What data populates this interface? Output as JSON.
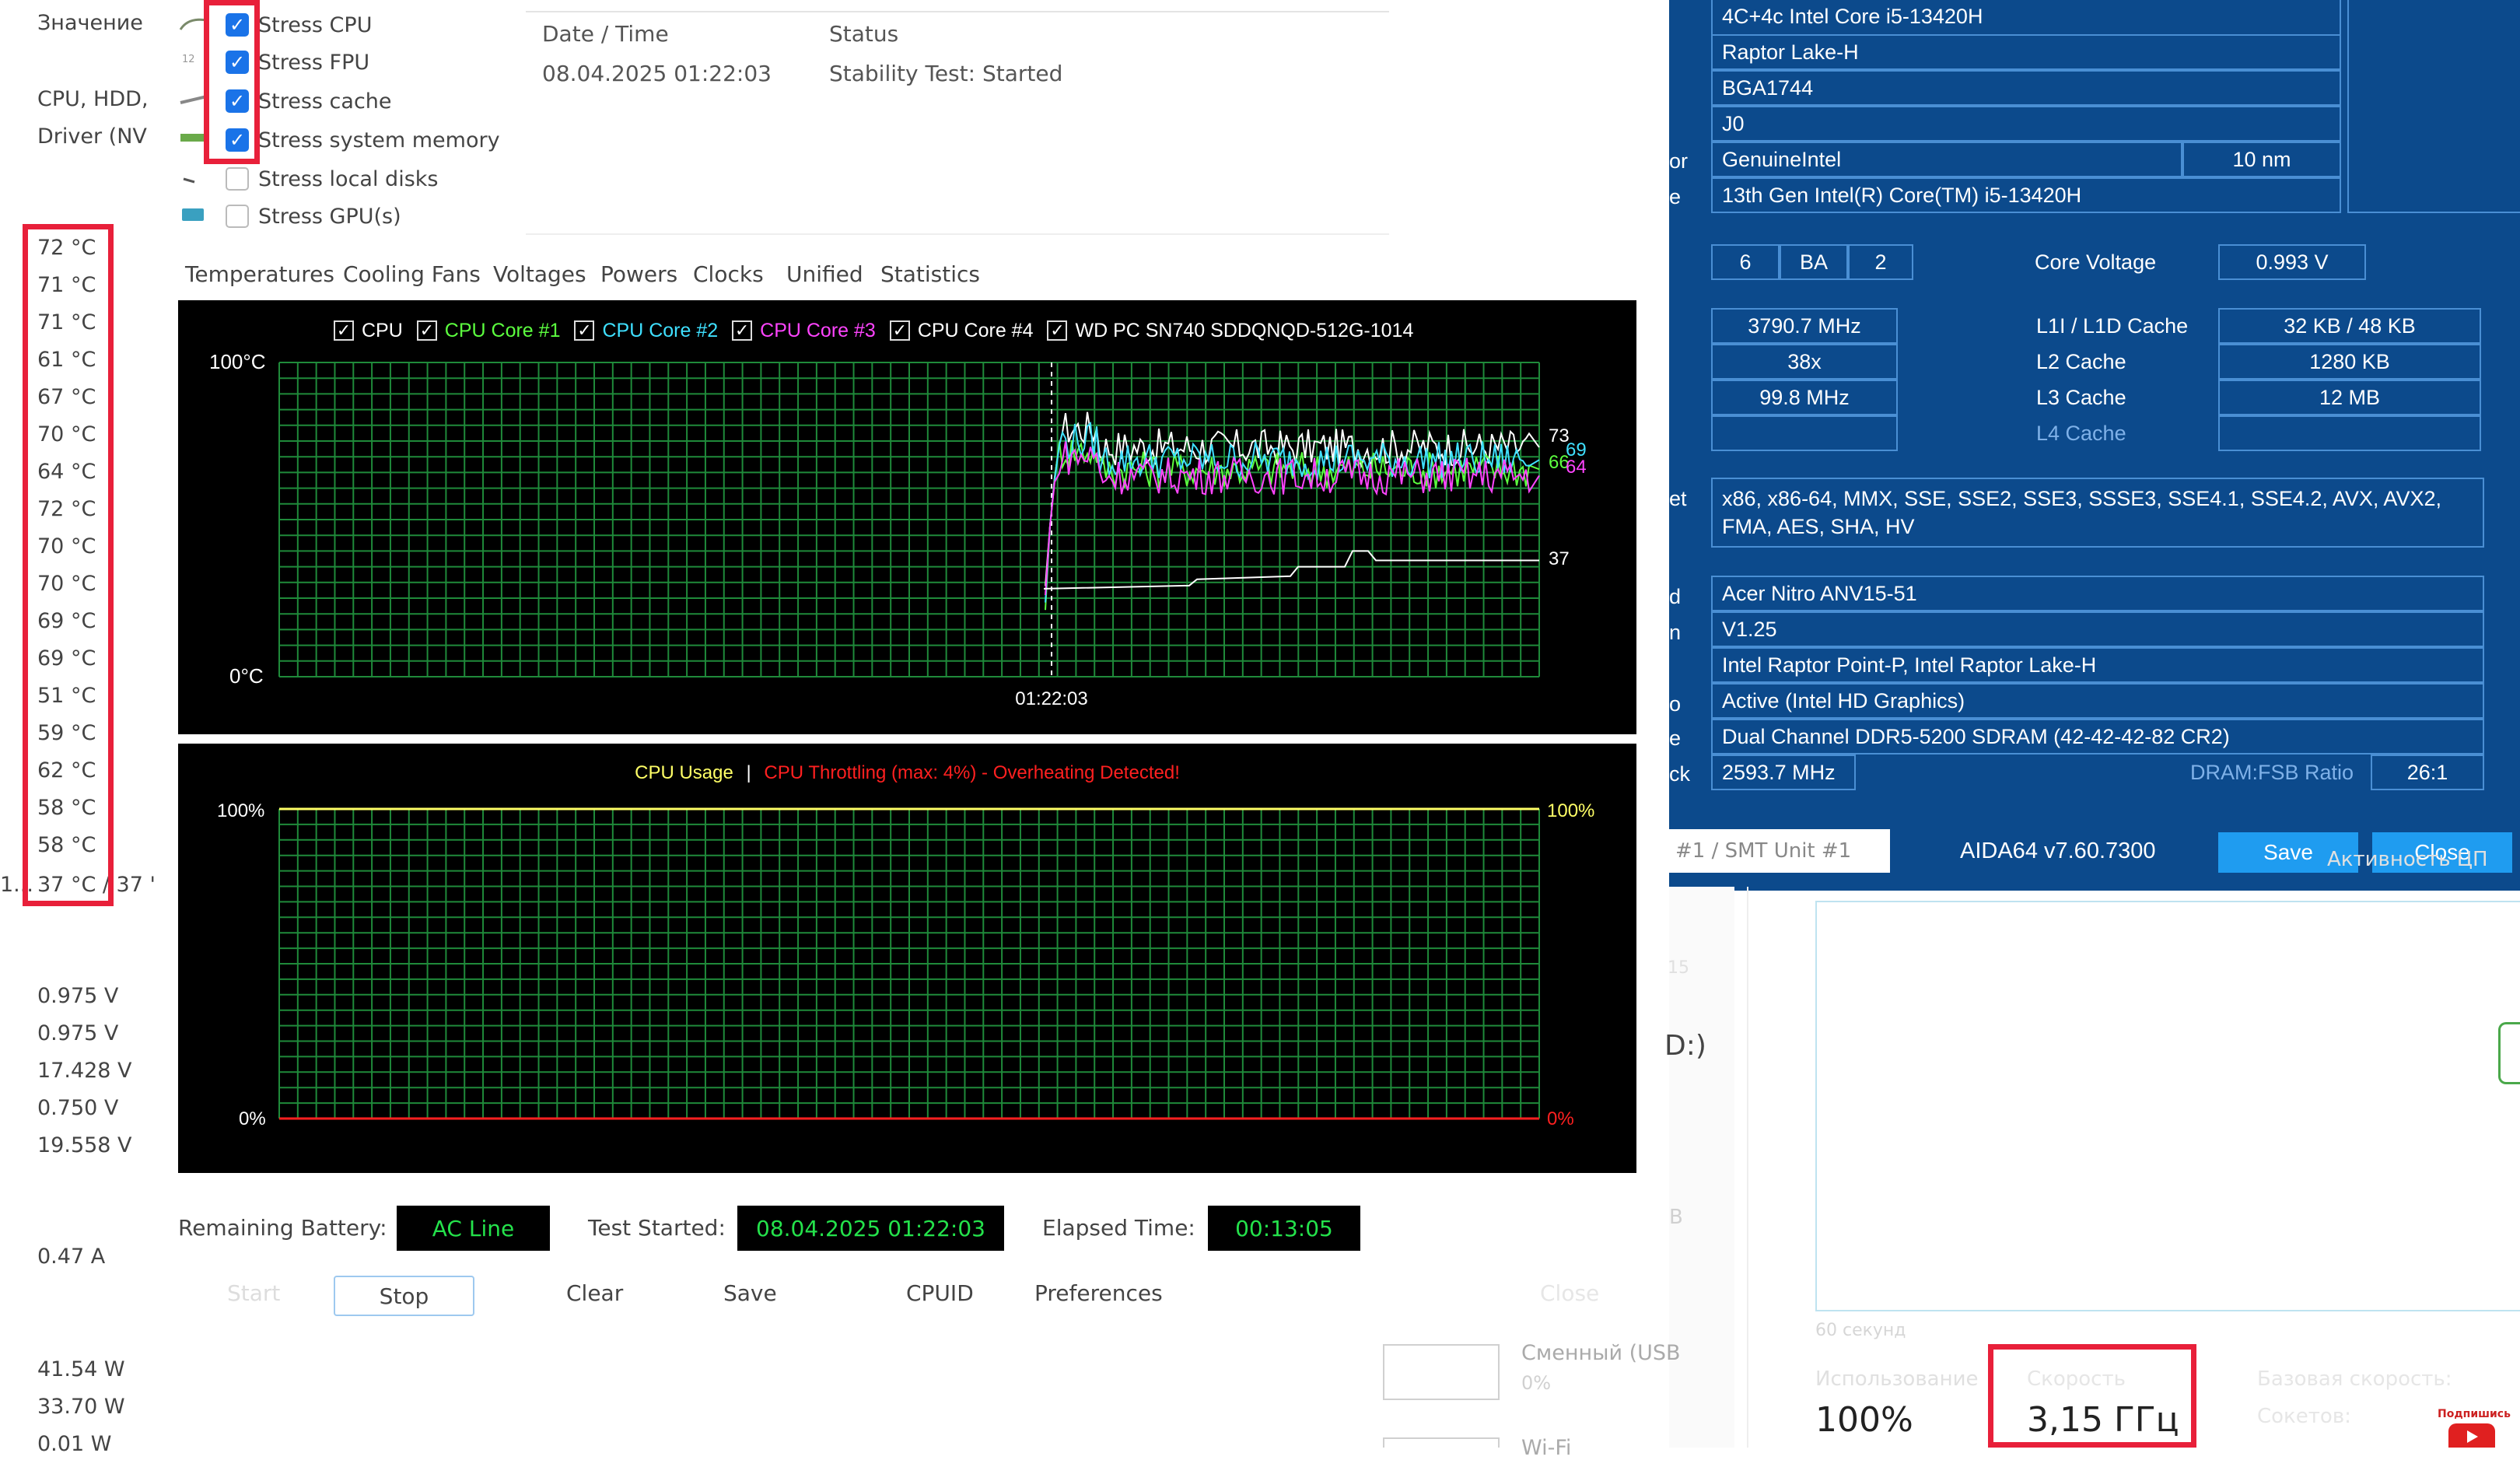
{
  "left_column": {
    "header": "Значение",
    "device_lines": [
      "CPU, HDD,",
      "Driver (NV"
    ],
    "temperatures": [
      "72 °C",
      "71 °C",
      "71 °C",
      "61 °C",
      "67 °C",
      "70 °C",
      "64 °C",
      "72 °C",
      "70 °C",
      "70 °C",
      "69 °C",
      "69 °C",
      "51 °C",
      "59 °C",
      "62 °C",
      "58 °C",
      "58 °C"
    ],
    "last_temp_prefix": "1...",
    "last_temp": "37 °C / 37 '",
    "voltages": [
      "0.975 V",
      "0.975 V",
      "17.428 V",
      "0.750 V",
      "19.558 V"
    ],
    "current": "0.47 A",
    "powers": [
      "41.54 W",
      "33.70 W",
      "0.01 W"
    ]
  },
  "stress_options": [
    {
      "label": "Stress CPU",
      "checked": true
    },
    {
      "label": "Stress FPU",
      "checked": true
    },
    {
      "label": "Stress cache",
      "checked": true
    },
    {
      "label": "Stress system memory",
      "checked": true
    },
    {
      "label": "Stress local disks",
      "checked": false
    },
    {
      "label": "Stress GPU(s)",
      "checked": false
    }
  ],
  "status_table": {
    "date_header": "Date / Time",
    "status_header": "Status",
    "date_value": "08.04.2025 01:22:03",
    "status_value": "Stability Test: Started"
  },
  "tabs": [
    "Temperatures",
    "Cooling Fans",
    "Voltages",
    "Powers",
    "Clocks",
    "Unified",
    "Statistics"
  ],
  "temp_graph": {
    "legend": [
      {
        "label": "CPU",
        "color": "#ffffff"
      },
      {
        "label": "CPU Core #1",
        "color": "#5cff3f"
      },
      {
        "label": "CPU Core #2",
        "color": "#3fe0ff"
      },
      {
        "label": "CPU Core #3",
        "color": "#ff44ff"
      },
      {
        "label": "CPU Core #4",
        "color": "#ffffff"
      },
      {
        "label": "WD PC SN740 SDDQNQD-512G-1014",
        "color": "#ffffff"
      }
    ],
    "y_top_label": "100°C",
    "y_bottom_label": "0°C",
    "x_label": "01:22:03",
    "right_labels": [
      {
        "text": "73",
        "color": "#ffffff"
      },
      {
        "text": "69",
        "color": "#3fe0ff"
      },
      {
        "text": "66",
        "color": "#5cff3f"
      },
      {
        "text": "64",
        "color": "#ff44ff"
      },
      {
        "text": "37",
        "color": "#ffffff"
      }
    ]
  },
  "usage_graph": {
    "title_usage": "CPU Usage",
    "separator": "|",
    "title_throttle": "CPU Throttling (max: 4%) - Overheating Detected!",
    "y_top_left": "100%",
    "y_bottom_left": "0%",
    "y_top_right": "100%",
    "y_bottom_right": "0%"
  },
  "chart_data": [
    {
      "type": "line",
      "ylim": [
        0,
        100
      ],
      "y_unit": "°C",
      "x_marker": "01:22:03",
      "series": [
        {
          "name": "CPU",
          "color": "#ffffff",
          "final": 73
        },
        {
          "name": "CPU Core #1",
          "color": "#5cff3f",
          "final": 66
        },
        {
          "name": "CPU Core #2",
          "color": "#3fe0ff",
          "final": 69
        },
        {
          "name": "CPU Core #3",
          "color": "#ff44ff",
          "final": 64
        },
        {
          "name": "WD PC SN740 SDDQNQD-512G-1014",
          "color": "#ffffff",
          "final": 37
        }
      ]
    },
    {
      "type": "line",
      "ylim": [
        0,
        100
      ],
      "y_unit": "%",
      "series": [
        {
          "name": "CPU Usage",
          "color": "#ffff66",
          "final": 100
        },
        {
          "name": "CPU Throttling",
          "color": "#ff2020",
          "final": 0
        }
      ]
    }
  ],
  "bottom_bar": {
    "remaining_battery_label": "Remaining Battery:",
    "remaining_battery_value": "AC Line",
    "test_started_label": "Test Started:",
    "test_started_value": "08.04.2025 01:22:03",
    "elapsed_label": "Elapsed Time:",
    "elapsed_value": "00:13:05",
    "buttons": [
      "Start",
      "Stop",
      "Clear",
      "Save",
      "CPUID",
      "Preferences",
      "Close"
    ]
  },
  "cpuid": {
    "cpu_name": "4C+4c Intel Core i5-13420H",
    "codename": "Raptor Lake-H",
    "package": "BGA1744",
    "stepping": "J0",
    "vendor_label": "or",
    "vendor": "GenuineIntel",
    "process": "10 nm",
    "name_label": "e",
    "full_name": "13th Gen Intel(R) Core(TM) i5-13420H",
    "family": "6",
    "model": "BA",
    "step": "2",
    "core_voltage_label": "Core Voltage",
    "core_voltage": "0.993 V",
    "clock": "3790.7 MHz",
    "multiplier": "38x",
    "bus": "99.8 MHz",
    "l1_label": "L1I / L1D Cache",
    "l1": "32 KB / 48 KB",
    "l2_label": "L2 Cache",
    "l2": "1280 KB",
    "l3_label": "L3 Cache",
    "l3": "12 MB",
    "l4_label": "L4 Cache",
    "iset_label": "et",
    "instructions": "x86, x86-64, MMX, SSE, SSE2, SSE3, SSSE3, SSE4.1, SSE4.2, AVX, AVX2, FMA, AES, SHA, HV",
    "board_label": "d",
    "motherboard": "Acer Nitro ANV15-51",
    "bios_label": "n",
    "bios": "V1.25",
    "chipset": "Intel Raptor Point-P, Intel Raptor Lake-H",
    "video_label": "o",
    "video": "Active  (Intel HD Graphics)",
    "memory_label": "e",
    "memory": "Dual Channel DDR5-5200 SDRAM  (42-42-42-82 CR2)",
    "mem_clock_label": "ck",
    "mem_clock": "2593.7 MHz",
    "dram_ratio_label": "DRAM:FSB Ratio",
    "dram_ratio": "26:1",
    "core_select": "#1 / SMT Unit #1",
    "version": "AIDA64 v7.60.7300",
    "save": "Save",
    "close": "Close"
  },
  "task_manager": {
    "disk_label": "D:)",
    "side_label_1": "B",
    "side_label_2": "15",
    "usb_label": "Сменный (USB",
    "usb_pct": "0%",
    "wifi_label": "Wi-Fi",
    "activity_label": "Активность ЦП",
    "seconds_label": "60 секунд",
    "usage_label": "Использование",
    "usage_value": "100%",
    "speed_label": "Скорость",
    "speed_value": "3,15 ГГц",
    "base_speed_label": "Базовая скорость:",
    "sockets_label": "Сокетов:",
    "subscribe_label": "Подпишись"
  }
}
